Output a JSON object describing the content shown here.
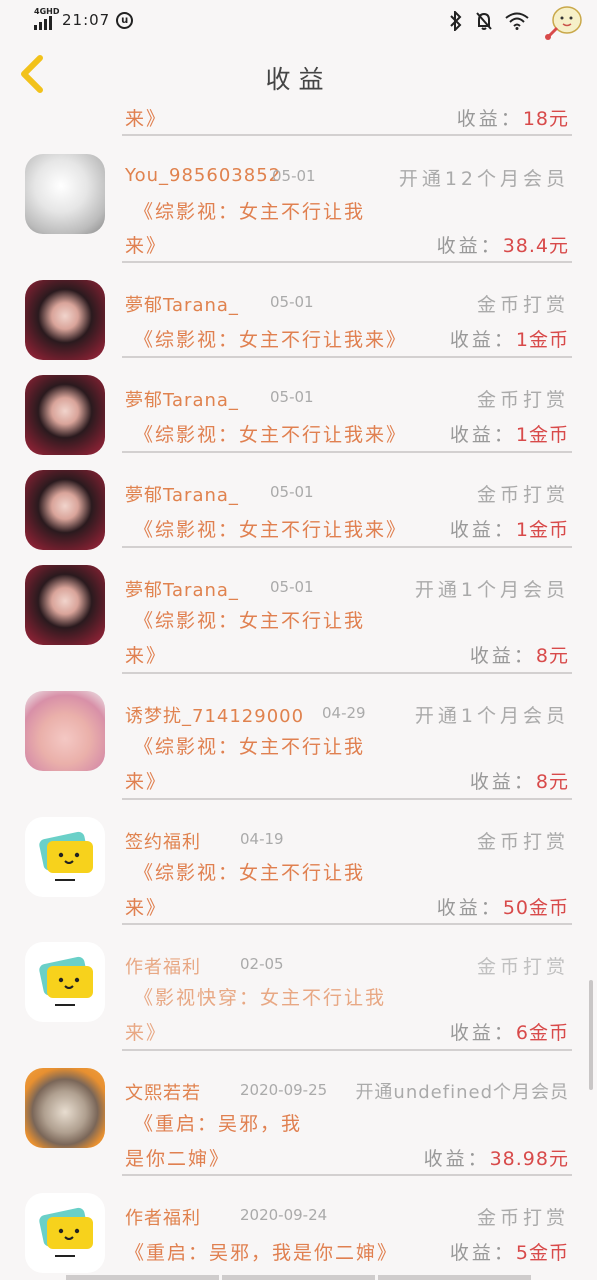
{
  "status": {
    "network": "4GHD",
    "time": "21:07",
    "circle_icon_text": "u"
  },
  "header": {
    "title": "收益"
  },
  "rows": [
    {
      "book2": "来》",
      "earn_label": "收益：",
      "earn_amt": "18元"
    },
    {
      "name": "You_985603852",
      "date": "05-01",
      "type": "开通12个月会员",
      "book1": "《综影视：女主不行让我",
      "book2": "来》",
      "earn_label": "收益：",
      "earn_amt": "38.4元"
    },
    {
      "name": "夢郁Tarana_",
      "date": "05-01",
      "type": "金币打赏",
      "book1": "《综影视：女主不行让我来》",
      "earn_label": "收益：",
      "earn_amt": "1金币"
    },
    {
      "name": "夢郁Tarana_",
      "date": "05-01",
      "type": "金币打赏",
      "book1": "《综影视：女主不行让我来》",
      "earn_label": "收益：",
      "earn_amt": "1金币"
    },
    {
      "name": "夢郁Tarana_",
      "date": "05-01",
      "type": "金币打赏",
      "book1": "《综影视：女主不行让我来》",
      "earn_label": "收益：",
      "earn_amt": "1金币"
    },
    {
      "name": "夢郁Tarana_",
      "date": "05-01",
      "type": "开通1个月会员",
      "book1": "《综影视：女主不行让我",
      "book2": "来》",
      "earn_label": "收益：",
      "earn_amt": "8元"
    },
    {
      "name": "诱梦扰_714129000",
      "date": "04-29",
      "type": "开通1个月会员",
      "book1": "《综影视：女主不行让我",
      "book2": "来》",
      "earn_label": "收益：",
      "earn_amt": "8元"
    },
    {
      "name": "签约福利",
      "date": "04-19",
      "type": "金币打赏",
      "book1": "《综影视：女主不行让我",
      "book2": "来》",
      "earn_label": "收益：",
      "earn_amt": "50金币"
    },
    {
      "name": "作者福利",
      "date": "02-05",
      "type": "金币打赏",
      "book1": "《影视快穿：女主不行让我",
      "book2": "来》",
      "earn_label": "收益：",
      "earn_amt": "6金币"
    },
    {
      "name": "文熙若若",
      "date": "2020-09-25",
      "type": "开通undefined个月会员",
      "book1": "《重启：吴邪，我",
      "book2": "是你二婶》",
      "earn_label": "收益：",
      "earn_amt": "38.98元"
    },
    {
      "name": "作者福利",
      "date": "2020-09-24",
      "type": "金币打赏",
      "book1": "《重启：吴邪，我是你二婶》",
      "earn_label": "收益：",
      "earn_amt": "5金币"
    }
  ],
  "icons": {
    "back": "chevron-left-icon",
    "bluetooth": "bluetooth-icon",
    "mute": "bell-off-icon",
    "wifi": "wifi-icon"
  },
  "colors": {
    "accent_orange": "#e08050",
    "amount_red": "#d84a4a",
    "back_yellow": "#f2c21a"
  }
}
